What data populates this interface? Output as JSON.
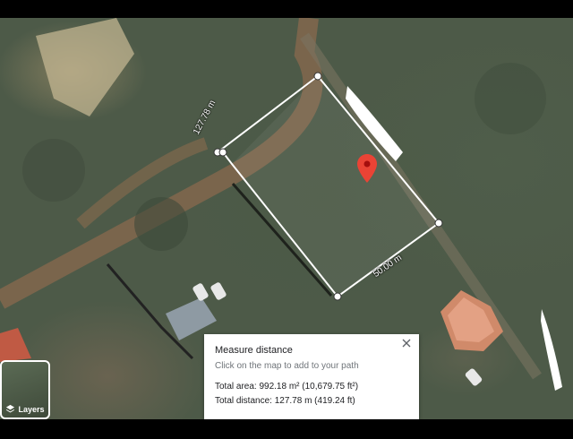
{
  "map": {
    "segment_labels": {
      "top_left_edge": "127.78 m",
      "bottom_right_edge": "50.00 m"
    }
  },
  "layers_button": {
    "label": "Layers",
    "icon": "layers-icon"
  },
  "measure_panel": {
    "title": "Measure distance",
    "hint": "Click on the map to add to your path",
    "total_area": "Total area: 992.18 m² (10,679.75 ft²)",
    "total_distance": "Total distance: 127.78 m (419.24 ft)",
    "close_icon": "close-icon"
  },
  "colors": {
    "measure_line": "#ffffff",
    "pin": "#ea4335",
    "panel_bg": "#ffffff"
  }
}
